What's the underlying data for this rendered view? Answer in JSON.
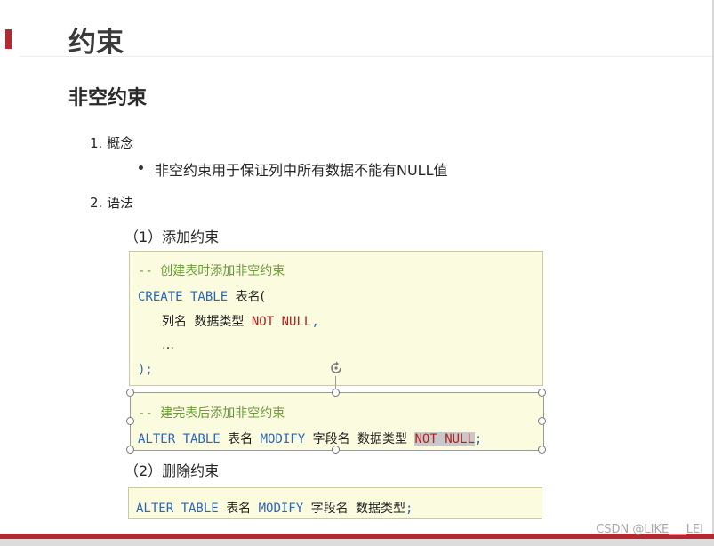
{
  "title": "约束",
  "subtitle": "非空约束",
  "section1": {
    "heading": "1. 概念",
    "bullet": "非空约束用于保证列中所有数据不能有NULL值"
  },
  "section2": {
    "heading": "2. 语法",
    "add": {
      "label": "（1）添加约束",
      "block1": {
        "comment": "-- 创建表时添加非空约束",
        "create": "CREATE TABLE",
        "table_name": "表名(",
        "col_name": "列名",
        "data_type": "数据类型",
        "not_null": "NOT NULL",
        "comma": ",",
        "ellipsis": "…",
        "close": ");"
      },
      "block2": {
        "comment": "-- 建完表后添加非空约束",
        "alter": "ALTER TABLE",
        "table_name": "表名",
        "modify": "MODIFY",
        "field_name": "字段名",
        "data_type": "数据类型",
        "not_null": "NOT NULL",
        "semicolon": ";"
      }
    },
    "drop": {
      "label": "（2）删除约束",
      "block": {
        "alter": "ALTER TABLE",
        "table_name": "表名",
        "modify": "MODIFY",
        "field_name": "字段名",
        "data_type": "数据类型",
        "semicolon": ";"
      }
    }
  },
  "watermark": "CSDN @LIKE___LEI",
  "colors": {
    "accent": "#b22a2f",
    "keyword": "#2f66b3",
    "comment": "#6c9a3a",
    "not_null": "#b3221f",
    "code_bg": "#fbfbe0"
  }
}
